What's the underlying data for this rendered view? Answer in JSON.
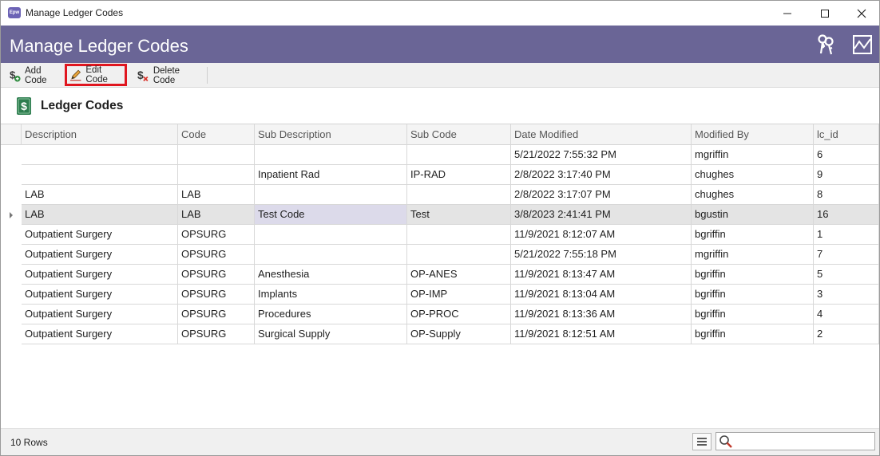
{
  "window": {
    "app_icon_text": "Epw",
    "title": "Manage Ledger Codes",
    "minimize_glyph": "—",
    "maximize_glyph": "☐",
    "close_glyph": "✕"
  },
  "header": {
    "title": "Manage Ledger Codes",
    "icons": [
      "keys-icon",
      "chart-icon"
    ],
    "color": "#6a6596"
  },
  "toolbar": {
    "add_label": "Add Code",
    "edit_label": "Edit Code",
    "delete_label": "Delete Code",
    "highlight_color": "#e0161f"
  },
  "section": {
    "title": "Ledger Codes"
  },
  "grid": {
    "columns": [
      "Description",
      "Code",
      "Sub Description",
      "Sub Code",
      "Date Modified",
      "Modified By",
      "lc_id"
    ],
    "rows": [
      [
        "",
        "",
        "",
        "",
        "5/21/2022 7:55:32 PM",
        "mgriffin",
        "6"
      ],
      [
        "",
        "",
        "Inpatient Rad",
        "IP-RAD",
        "2/8/2022 3:17:40 PM",
        "chughes",
        "9"
      ],
      [
        "LAB",
        "LAB",
        "",
        "",
        "2/8/2022 3:17:07 PM",
        "chughes",
        "8"
      ],
      [
        "LAB",
        "LAB",
        "Test Code",
        "Test",
        "3/8/2023 2:41:41 PM",
        "bgustin",
        "16"
      ],
      [
        "Outpatient Surgery",
        "OPSURG",
        "",
        "",
        "11/9/2021 8:12:07 AM",
        "bgriffin",
        "1"
      ],
      [
        "Outpatient Surgery",
        "OPSURG",
        "",
        "",
        "5/21/2022 7:55:18 PM",
        "mgriffin",
        "7"
      ],
      [
        "Outpatient Surgery",
        "OPSURG",
        "Anesthesia",
        "OP-ANES",
        "11/9/2021 8:13:47 AM",
        "bgriffin",
        "5"
      ],
      [
        "Outpatient Surgery",
        "OPSURG",
        "Implants",
        "OP-IMP",
        "11/9/2021 8:13:04 AM",
        "bgriffin",
        "3"
      ],
      [
        "Outpatient Surgery",
        "OPSURG",
        "Procedures",
        "OP-PROC",
        "11/9/2021 8:13:36 AM",
        "bgriffin",
        "4"
      ],
      [
        "Outpatient Surgery",
        "OPSURG",
        "Surgical Supply",
        "OP-Supply",
        "11/9/2021 8:12:51 AM",
        "bgriffin",
        "2"
      ]
    ],
    "selected_row": 3,
    "active_column": 2
  },
  "status": {
    "row_count": "10 Rows",
    "search_value": "",
    "search_placeholder": ""
  }
}
